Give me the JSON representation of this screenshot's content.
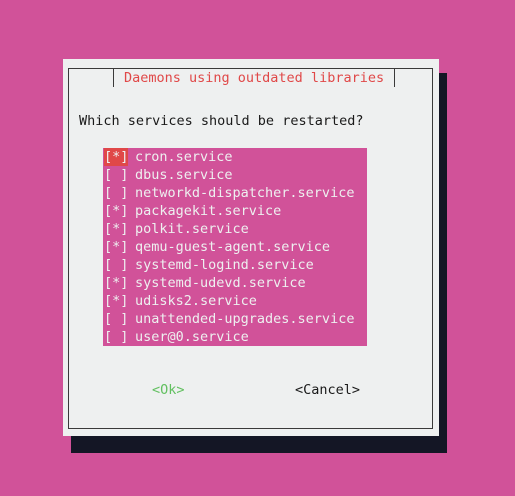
{
  "dialog": {
    "title": "Daemons using outdated libraries",
    "prompt": "Which services should be restarted?",
    "ok_label": "<Ok>",
    "cancel_label": "<Cancel>"
  },
  "services": [
    {
      "mark": "[*]",
      "name": "cron.service"
    },
    {
      "mark": "[ ]",
      "name": "dbus.service"
    },
    {
      "mark": "[ ]",
      "name": "networkd-dispatcher.service"
    },
    {
      "mark": "[*]",
      "name": "packagekit.service"
    },
    {
      "mark": "[*]",
      "name": "polkit.service"
    },
    {
      "mark": "[*]",
      "name": "qemu-guest-agent.service"
    },
    {
      "mark": "[ ]",
      "name": "systemd-logind.service"
    },
    {
      "mark": "[*]",
      "name": "systemd-udevd.service"
    },
    {
      "mark": "[*]",
      "name": "udisks2.service"
    },
    {
      "mark": "[ ]",
      "name": "unattended-upgrades.service"
    },
    {
      "mark": "[ ]",
      "name": "user@0.service"
    }
  ],
  "colors": {
    "background": "#d15299",
    "dialog": "#eef0f0",
    "title": "#e04848",
    "ok": "#62c060",
    "shadow": "#141625"
  }
}
